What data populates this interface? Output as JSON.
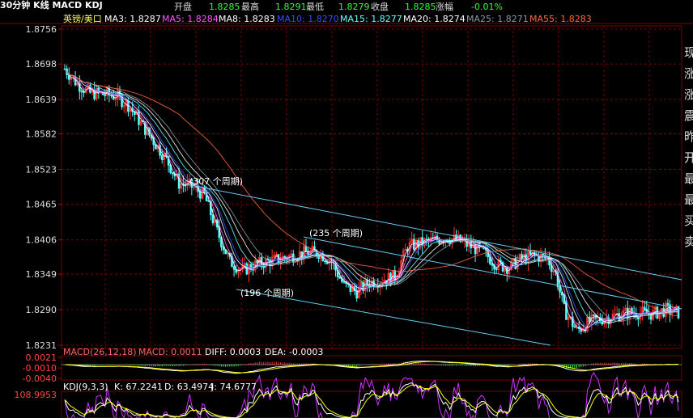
{
  "header": {
    "period_title": "30分钟 K线 MACD KDJ",
    "open_label": "开盘",
    "open_value": "1.8285",
    "high_label": "最高",
    "high_value": "1.8291",
    "low_label": "最低",
    "low_value": "1.8279",
    "close_label": "收盘",
    "close_value": "1.8285",
    "change_label": "涨幅",
    "change_value": "-0.01%"
  },
  "ma_legend": {
    "symbol": "英镑/美口",
    "items": [
      {
        "label": "MA3: 1.8287",
        "color": "#ffffff"
      },
      {
        "label": "MA5: 1.8284",
        "color": "#ff55ff"
      },
      {
        "label": "MA8: 1.8283",
        "color": "#ffffff"
      },
      {
        "label": "MA10: 1.8270",
        "color": "#3050ff"
      },
      {
        "label": "MA15: 1.8277",
        "color": "#66ffff"
      },
      {
        "label": "MA20: 1.8274",
        "color": "#ffffff"
      },
      {
        "label": "MA25: 1.8271",
        "color": "#8899aa"
      },
      {
        "label": "MA55: 1.8283",
        "color": "#ff6644"
      }
    ]
  },
  "right_panel_chars": [
    "现",
    "涨",
    "涨",
    "震",
    "昨",
    "开",
    "最",
    "最",
    "买",
    "卖"
  ],
  "colors": {
    "up": "#ff3333",
    "down": "#55ffff",
    "grid": "#7a0000",
    "channel": "#66ccee"
  },
  "chart_data": [
    {
      "type": "candlestick",
      "title": "英镑/美口 30分钟 K线",
      "y_ticks": [
        "1.8756",
        "1.8698",
        "1.8639",
        "1.8582",
        "1.8523",
        "1.8465",
        "1.8406",
        "1.8349",
        "1.8290",
        "1.8231"
      ],
      "ylim": [
        1.8231,
        1.8756
      ],
      "approx_close_path": [
        [
          0,
          1.869
        ],
        [
          6,
          1.8665
        ],
        [
          12,
          1.865
        ],
        [
          18,
          1.8648
        ],
        [
          24,
          1.8645
        ],
        [
          30,
          1.863
        ],
        [
          36,
          1.86
        ],
        [
          42,
          1.857
        ],
        [
          48,
          1.854
        ],
        [
          54,
          1.85
        ],
        [
          60,
          1.8495
        ],
        [
          66,
          1.848
        ],
        [
          72,
          1.842
        ],
        [
          78,
          1.837
        ],
        [
          84,
          1.8355
        ],
        [
          90,
          1.8365
        ],
        [
          96,
          1.837
        ],
        [
          102,
          1.8375
        ],
        [
          108,
          1.838
        ],
        [
          114,
          1.8385
        ],
        [
          120,
          1.8385
        ],
        [
          126,
          1.837
        ],
        [
          132,
          1.833
        ],
        [
          138,
          1.832
        ],
        [
          144,
          1.8335
        ],
        [
          150,
          1.834
        ],
        [
          156,
          1.8345
        ],
        [
          162,
          1.8395
        ],
        [
          168,
          1.84
        ],
        [
          174,
          1.8405
        ],
        [
          180,
          1.841
        ],
        [
          186,
          1.8405
        ],
        [
          192,
          1.8395
        ],
        [
          198,
          1.8385
        ],
        [
          204,
          1.8365
        ],
        [
          210,
          1.836
        ],
        [
          216,
          1.8375
        ],
        [
          222,
          1.838
        ],
        [
          228,
          1.8375
        ],
        [
          232,
          1.835
        ],
        [
          236,
          1.829
        ],
        [
          242,
          1.8255
        ],
        [
          248,
          1.827
        ],
        [
          254,
          1.8275
        ],
        [
          260,
          1.828
        ],
        [
          266,
          1.8285
        ],
        [
          272,
          1.8285
        ],
        [
          278,
          1.8283
        ],
        [
          284,
          1.829
        ],
        [
          290,
          1.8285
        ]
      ],
      "annotations": [
        {
          "text": "(307 个周期)"
        },
        {
          "text": "(235 个周期)"
        },
        {
          "text": "(196 个周期)"
        }
      ]
    },
    {
      "type": "bar",
      "title": "MACD(26,12,18)",
      "series": [
        {
          "name": "MACD",
          "last": 0.0011
        },
        {
          "name": "DIFF",
          "last": 0.0003
        },
        {
          "name": "DEA",
          "last": -0.0003
        }
      ],
      "y_ticks": [
        "0.0021",
        "-0.0010",
        "-0.0040"
      ]
    },
    {
      "type": "line",
      "title": "KDJ(9,3,3)",
      "series": [
        {
          "name": "K",
          "last": 67.2241
        },
        {
          "name": "D",
          "last": 63.4974
        },
        {
          "name": "J",
          "last": 74.6777
        }
      ],
      "y_ticks": [
        "108.9953"
      ]
    }
  ],
  "macd_legend": {
    "title": "MACD(26,12,18)",
    "macd": "MACD: 0.0011",
    "diff": "DIFF: 0.0003",
    "dea": "DEA: -0.0003"
  },
  "kdj_legend": {
    "title": "KDJ(9,3,3)",
    "k": "K: 67.2241",
    "d": "D: 63.4974",
    "j": "J: 74.6777"
  }
}
